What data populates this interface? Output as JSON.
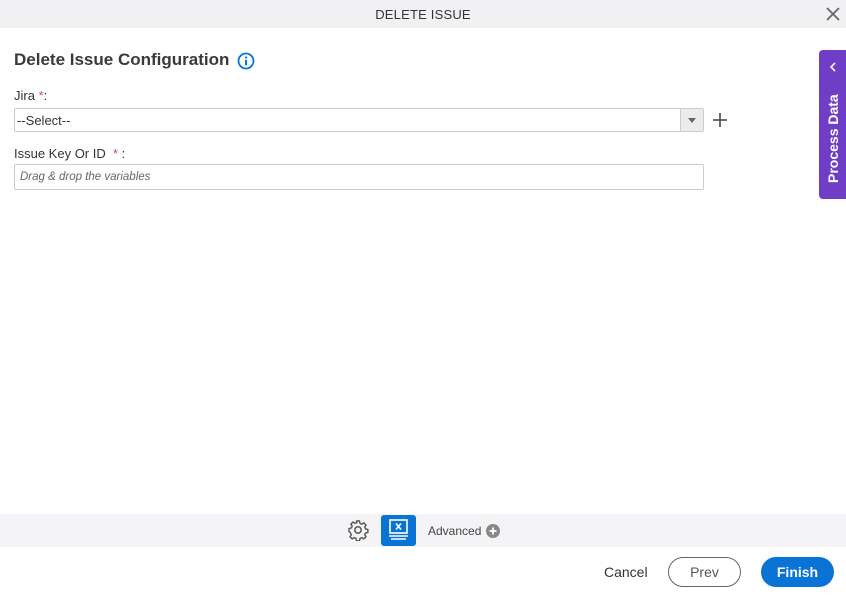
{
  "window": {
    "title": "DELETE ISSUE",
    "close_icon": "close-icon"
  },
  "main": {
    "heading": "Delete Issue Configuration",
    "info_icon": "info-icon",
    "fields": [
      {
        "label": "Jira",
        "required_mark": "*",
        "suffix": ":",
        "type": "select",
        "value": "--Select--"
      },
      {
        "label": "Issue Key Or ID",
        "required_mark": "*",
        "suffix": " :",
        "type": "text",
        "placeholder": "Drag & drop the variables",
        "value": ""
      }
    ]
  },
  "side_panel": {
    "label": "Process Data"
  },
  "toolbar": {
    "advanced_label": "Advanced"
  },
  "footer": {
    "cancel_label": "Cancel",
    "prev_label": "Prev",
    "finish_label": "Finish"
  },
  "colors": {
    "accent": "#0a74d6",
    "side_tab": "#6f3dc6",
    "required": "#d24b4b"
  }
}
